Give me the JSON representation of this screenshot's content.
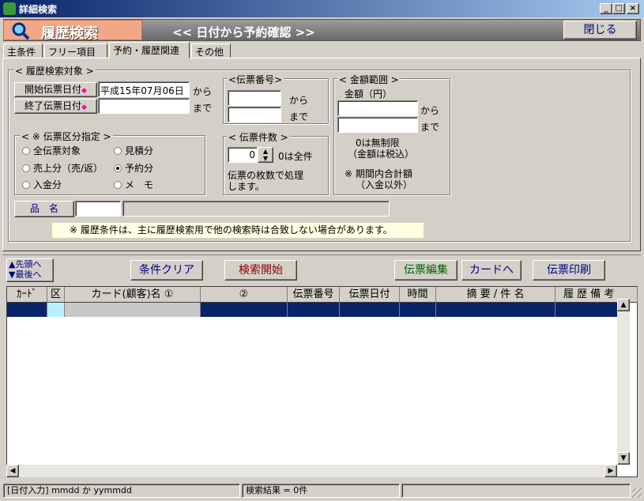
{
  "window": {
    "title": "詳細検索",
    "min": "_",
    "max": "□",
    "close": "×"
  },
  "header": {
    "title": "履歴検索",
    "subtitle": "<< 日付から予約確認 >>",
    "close_label": "閉じる"
  },
  "tabs": [
    {
      "label": "主条件"
    },
    {
      "label": "フリー項目"
    },
    {
      "label": "予約・履歴関連"
    },
    {
      "label": "その他"
    }
  ],
  "history": {
    "caption": "< 履歴検索対象 >",
    "start_label": "開始伝票日付",
    "start_value": "平成15年07月06日",
    "start_suffix": "から",
    "end_label": "終了伝票日付",
    "end_value": "",
    "end_suffix": "まで"
  },
  "denpyo_no": {
    "caption": "<伝票番号>",
    "from": "から",
    "to": "まで"
  },
  "amount": {
    "caption": "< 金額範囲 >",
    "label": "金額（円）",
    "from": "から",
    "to": "まで",
    "note1": "0は無制限",
    "note2": "（金額は税込）",
    "note3": "※ 期間内合計額",
    "note4": "（入金以外）"
  },
  "kubun": {
    "caption": "< ※ 伝票区分指定 >",
    "options": [
      "全伝票対象",
      "見積分",
      "売上分（売/返）",
      "予約分",
      "入金分",
      "メ　モ"
    ],
    "selected": 3
  },
  "count": {
    "caption": "< 伝票件数 >",
    "value": "0",
    "hint": "0は全件",
    "desc1": "伝票の枚数で処理",
    "desc2": "します。"
  },
  "item": {
    "label": "品　名"
  },
  "note": "※ 履歴条件は、主に履歴検索用で他の検索時は合致しない場合があります。",
  "toolbar": {
    "first": "▲先頭へ",
    "last": "▼最後へ",
    "clear": "条件クリア",
    "search": "検索開始",
    "edit": "伝票編集",
    "card": "カードへ",
    "print": "伝票印刷"
  },
  "grid": {
    "columns": [
      "ｶｰﾄﾞ",
      "区",
      "カード(顧客)名 ①",
      "②",
      "伝票番号",
      "伝票日付",
      "時間",
      "摘 要 / 件 名",
      "履 歴 備 考"
    ]
  },
  "status": {
    "hint": "[日付入力] mmdd か yymmdd",
    "result": "検索結果 = 0件"
  },
  "colors": {
    "title_start": "#0a246a",
    "title_end": "#a6caf0",
    "header_accent": "#f0a888",
    "selection": "#0a246a",
    "note_bg": "#ffffe1"
  }
}
